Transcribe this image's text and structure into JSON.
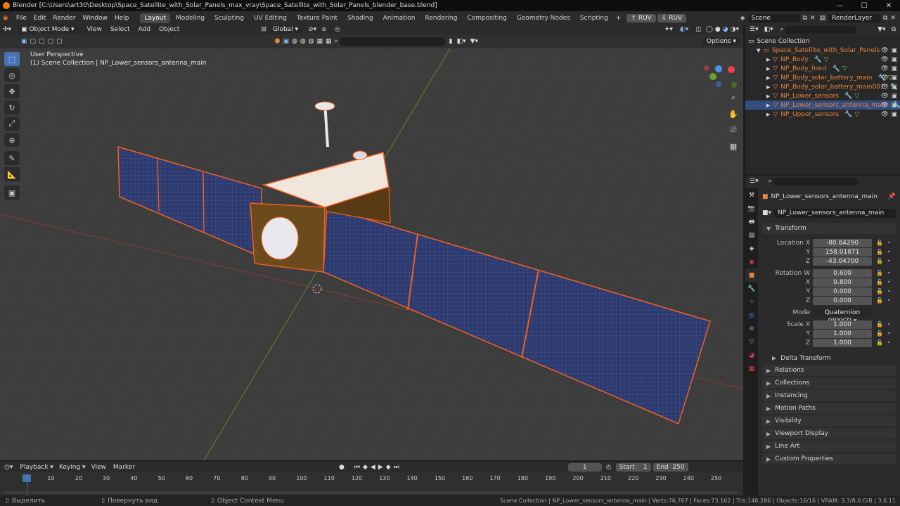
{
  "window": {
    "title": "Blender [C:\\Users\\art30\\Desktop\\Space_Satellite_with_Solar_Panels_max_vray\\Space_Satellite_with_Solar_Panels_blender_base.blend]",
    "min": "—",
    "max": "☐",
    "close": "✕"
  },
  "menu": [
    "File",
    "Edit",
    "Render",
    "Window",
    "Help"
  ],
  "workspaces": [
    "Layout",
    "Modeling",
    "Sculpting",
    "UV Editing",
    "Texture Paint",
    "Shading",
    "Animation",
    "Rendering",
    "Compositing",
    "Geometry Nodes",
    "Scripting"
  ],
  "plugins": [
    "RUV",
    "RUV"
  ],
  "scene": {
    "name": "Scene",
    "layer": "RenderLayer"
  },
  "viewport": {
    "mode": "Object Mode",
    "menus": [
      "View",
      "Select",
      "Add",
      "Object"
    ],
    "orientation": "Global",
    "perspective": "User Perspective",
    "context": "(1) Scene Collection | NP_Lower_sensors_antenna_main",
    "options": "Options"
  },
  "outliner": {
    "root": "Scene Collection",
    "collection": "Space_Satellite_with_Solar_Panels",
    "items": [
      "NP_Body",
      "NP_Body_front",
      "NP_Body_solar_battery_main",
      "NP_Body_solar_battery_main001",
      "NP_Lower_sensors",
      "NP_Lower_sensors_antenna_main",
      "NP_Upper_sensors"
    ],
    "selected_index": 5
  },
  "properties": {
    "object_name": "NP_Lower_sensors_antenna_main",
    "data_name": "NP_Lower_sensors_antenna_main",
    "transform_label": "Transform",
    "location": {
      "label": "Location X",
      "x": "-80.84290",
      "y": "158.01871",
      "z": "-43.04700"
    },
    "rotation": {
      "label": "Rotation W",
      "w": "0.600",
      "x": "0.800",
      "y": "0.000",
      "z": "0.000"
    },
    "mode_label": "Mode",
    "mode_value": "Quaternion (WXYZ)",
    "scale": {
      "label": "Scale X",
      "x": "1.000",
      "y": "1.000",
      "z": "1.000"
    },
    "axis": {
      "x": "X",
      "y": "Y",
      "z": "Z"
    },
    "delta": "Delta Transform",
    "panels": [
      "Relations",
      "Collections",
      "Instancing",
      "Motion Paths",
      "Visibility",
      "Viewport Display",
      "Line Art",
      "Custom Properties"
    ]
  },
  "timeline": {
    "menus": [
      "Playback",
      "Keying",
      "View",
      "Marker"
    ],
    "current": "1",
    "start_label": "Start",
    "start": "1",
    "end_label": "End",
    "end": "250",
    "ticks": [
      "1",
      "10",
      "20",
      "30",
      "40",
      "50",
      "60",
      "70",
      "80",
      "90",
      "100",
      "110",
      "120",
      "130",
      "140",
      "150",
      "160",
      "170",
      "180",
      "190",
      "200",
      "210",
      "220",
      "230",
      "240",
      "250"
    ]
  },
  "status": {
    "left": [
      "Выделить",
      "Повернуть вид",
      "Object Context Menu"
    ],
    "right": "Scene Collection | NP_Lower_sensors_antenna_main | Verts:76,767 | Faces:73,162 | Tris:146,286 | Objects:16/16 | VRAM: 3.3/8.0 GiB | 3.6.11"
  }
}
